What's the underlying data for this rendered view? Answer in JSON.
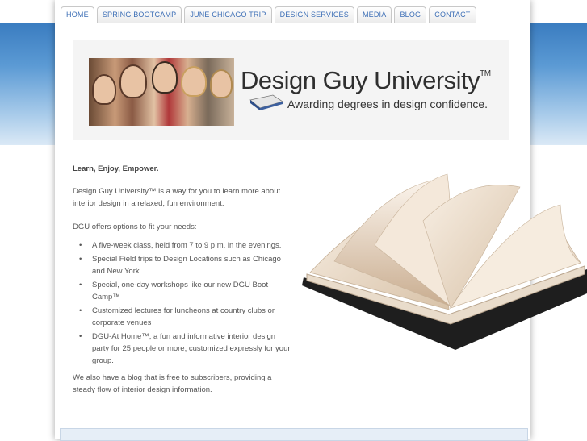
{
  "nav": {
    "tabs": [
      {
        "label": "HOME",
        "active": true
      },
      {
        "label": "SPRING BOOTCAMP"
      },
      {
        "label": "JUNE CHICAGO TRIP"
      },
      {
        "label": "DESIGN SERVICES"
      },
      {
        "label": "MEDIA"
      },
      {
        "label": "BLOG"
      },
      {
        "label": "CONTACT"
      }
    ]
  },
  "header": {
    "brand": "Design Guy University",
    "tm": "TM",
    "tagline": "Awarding degrees in design confidence."
  },
  "content": {
    "lead": "Learn, Enjoy, Empower.",
    "intro": "Design Guy University™ is a way for you to learn more about interior design in a relaxed, fun environment.",
    "options_intro": "DGU offers options to fit your needs:",
    "options": [
      "A five-week class, held from 7 to 9 p.m. in the evenings.",
      "Special Field trips to Design Locations such as Chicago and New York",
      "Special, one-day workshops like our new DGU Boot Camp™",
      "Customized lectures for luncheons at country clubs or corporate venues",
      "DGU-At Home™, a fun and informative interior design party for 25 people or more, customized expressly for your group."
    ],
    "blog_note": "We also have a blog that is free to subscribers, providing a steady flow of interior design information."
  },
  "colors": {
    "nav_text": "#3d6fb6",
    "band_top": "#3a7cc0",
    "band_bottom": "#dbe9f6"
  }
}
